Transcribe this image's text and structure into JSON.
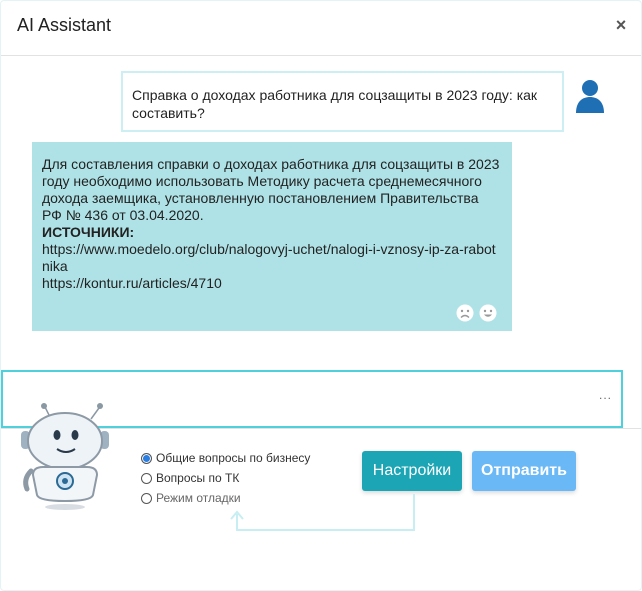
{
  "window": {
    "title": "AI Assistant",
    "close_label": "×"
  },
  "chat": {
    "user_message": "Справка о доходах работника для соцзащиты в 2023 году: как составить?",
    "bot_answer": "Для составления справки о доходах работника для соцзащиты в 2023 году необходимо использовать Методику расчета среднемесячного дохода заемщика, установленную постановлением Правительства РФ № 436 от 03.04.2020.",
    "sources_title": "ИСТОЧНИКИ:",
    "sources": [
      "https://www.moedelo.org/club/nalogovyj-uchet/nalogi-i-vznosy-ip-za-rabotnika",
      "https://kontur.ru/articles/4710"
    ]
  },
  "input": {
    "value": "",
    "placeholder": "",
    "dots": "..."
  },
  "modes": [
    {
      "label": "Общие вопросы по бизнесу",
      "checked": true
    },
    {
      "label": "Вопросы по ТК",
      "checked": false
    },
    {
      "label": "Режим отладки",
      "checked": false
    }
  ],
  "buttons": {
    "settings": "Настройки",
    "send": "Отправить"
  },
  "colors": {
    "bot_bubble": "#afe2e6",
    "user_bubble_border": "#cdeff3",
    "input_border": "#4fd1dd",
    "settings_button": "#1ca5b5",
    "send_button": "#6ab8f6",
    "radio_selected": "#2a7de1"
  },
  "icons": {
    "close": "close-icon",
    "user": "user-avatar-icon",
    "dislike": "sad-face-icon",
    "like": "happy-face-icon",
    "mascot": "robot-mascot"
  }
}
